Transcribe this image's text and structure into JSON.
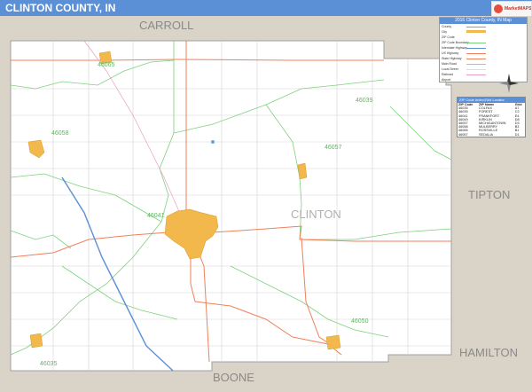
{
  "title": "CLINTON COUNTY, IN",
  "logo": {
    "text": "MarketMAPS"
  },
  "colors": {
    "title_bar": "#5b8fd6",
    "outside_area": "#d9d4c7",
    "county_fill": "#ffffff",
    "county_border": "#b0b0b0",
    "zip_boundary": "#7ed07e",
    "zip_label": "#66b366",
    "highway": "#ff7f50",
    "interstate": "#5b8fd6",
    "local_road": "#cccccc",
    "city_fill": "#f2b84b",
    "neighbor_label": "#8a8a8a"
  },
  "map": {
    "neighbor_counties": [
      "CARROLL",
      "TIPTON",
      "HAMILTON",
      "BOONE"
    ],
    "county_label": "CLINTON",
    "zip_labels": [
      "46065",
      "46039",
      "46058",
      "46057",
      "46041",
      "46050",
      "46035"
    ]
  },
  "legend": {
    "title": "2016 Clinton County, IN Map",
    "rows": [
      "County",
      "City",
      "ZIP Code",
      "ZIP Code Boundary",
      "Interstate Highway",
      "US Highway",
      "State Highway",
      "Main Road",
      "Local Street",
      "Railroad",
      "Airport"
    ]
  },
  "zip_index": {
    "title": "ZIP Code Index/Grid Locator",
    "headers": [
      "ZIP Code",
      "ZIP Name",
      "Grid"
    ],
    "rows": [
      [
        "46035",
        "COLFAX",
        "A7"
      ],
      [
        "46039",
        "FOREST",
        "C2"
      ],
      [
        "46041",
        "FRANKFORT",
        "E4"
      ],
      [
        "46049",
        "KIRKLIN",
        "D8"
      ],
      [
        "46057",
        "MICHIGANTOWN",
        "D3"
      ],
      [
        "46058",
        "MULBERRY",
        "B3"
      ],
      [
        "46065",
        "ROSSVILLE",
        "B1"
      ],
      [
        "46067",
        "SEDALIA",
        "D1"
      ]
    ]
  }
}
